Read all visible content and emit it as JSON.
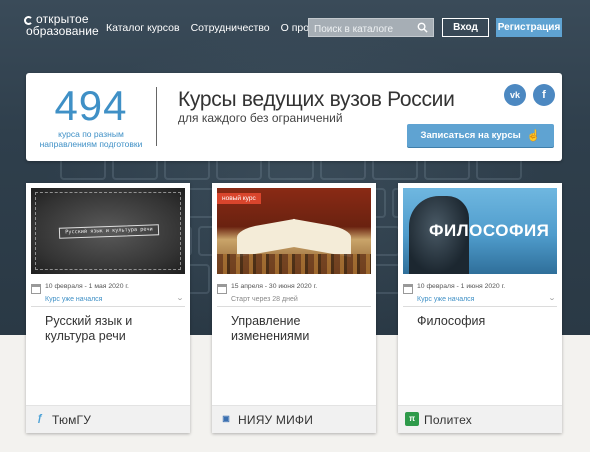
{
  "header": {
    "logo_line1": "открытое",
    "logo_line2": "образование",
    "nav": [
      "Каталог курсов",
      "Сотрудничество",
      "О проекте"
    ],
    "search_placeholder": "Поиск в каталоге",
    "login_label": "Вход",
    "register_label": "Регистрация"
  },
  "promo": {
    "count": "494",
    "count_caption_1": "курса по разным",
    "count_caption_2": "направлениям подготовки",
    "title": "Курсы ведущих вузов России",
    "subtitle": "для каждого без ограничений",
    "enroll_label": "Записаться на курсы",
    "social": {
      "vk_label": "vk",
      "fb_label": "f"
    }
  },
  "courses": [
    {
      "dates": "10 февраля - 1 мая 2020 г.",
      "status": "Курс уже начался",
      "title": "Русский язык и культура речи",
      "university": "ТюмГУ",
      "thumb_text": "Русский язык и культура речи",
      "uni_icon": "tyumgu-logo-icon",
      "uni_color": "#4aa0d6"
    },
    {
      "dates": "15 апреля - 30 июня 2020 г.",
      "status": "Старт через 28 дней",
      "title": "Управление изменениями",
      "university": "НИЯУ МИФИ",
      "badge": "новый курс",
      "uni_icon": "mephi-logo-icon",
      "uni_color": "#3a6fb0"
    },
    {
      "dates": "10 февраля - 1 июня 2020 г.",
      "status": "Курс уже начался",
      "title": "Философия",
      "university": "Политех",
      "thumb_text": "ФИЛОСОФИЯ",
      "uni_icon": "polytech-logo-icon",
      "uni_color": "#2e9a4a"
    }
  ],
  "colors": {
    "accent": "#5fa3d2",
    "count_blue": "#3f90c6",
    "hero_dark": "#2f3f4c"
  }
}
